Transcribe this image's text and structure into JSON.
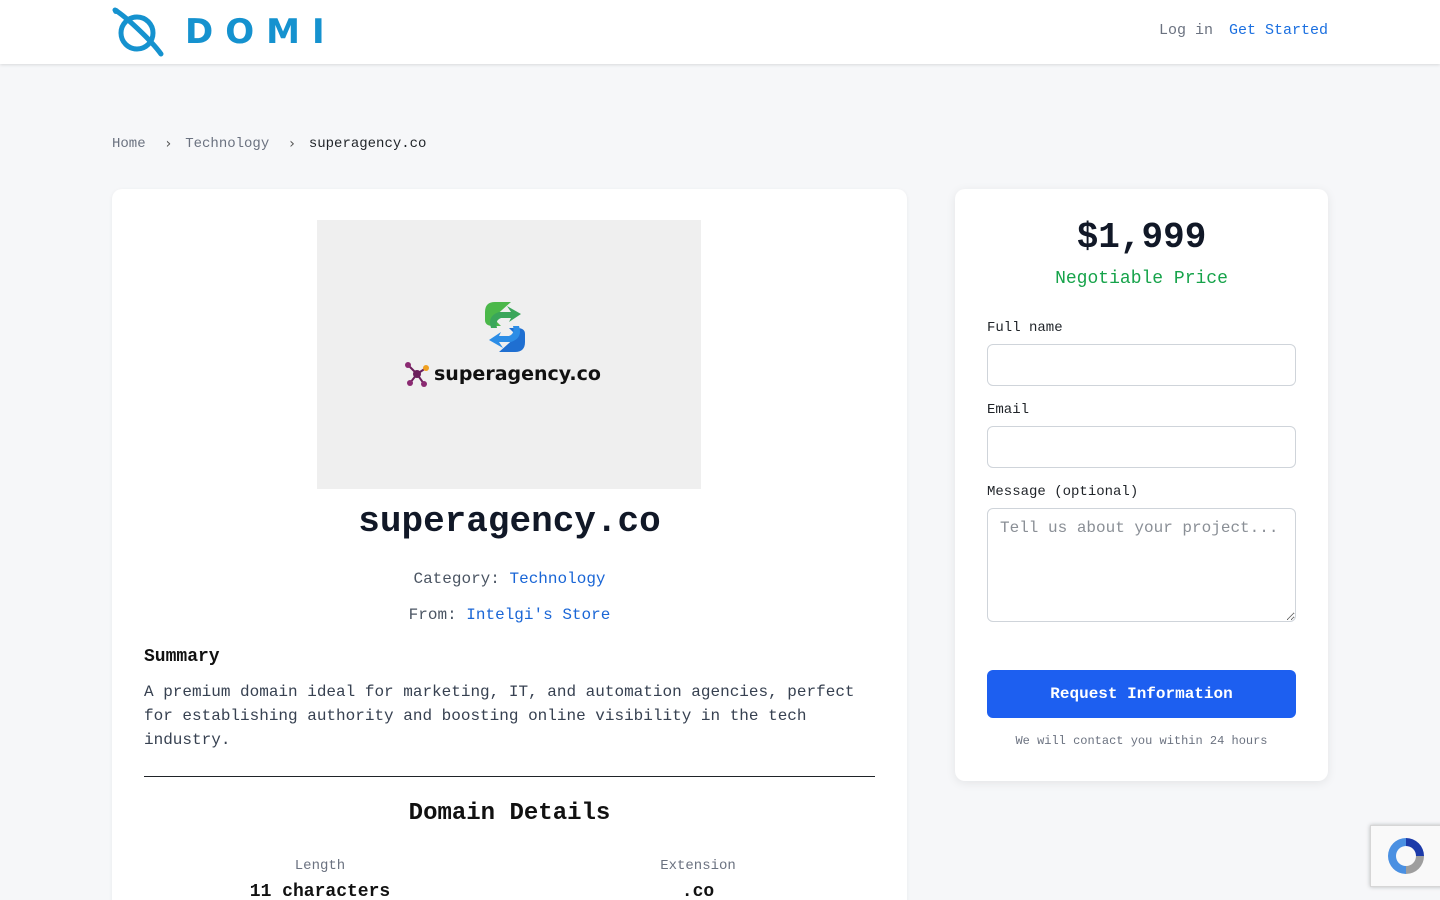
{
  "header": {
    "logo_text": "DOMI",
    "login_label": "Log in",
    "get_started_label": "Get Started"
  },
  "breadcrumb": {
    "home": "Home",
    "category": "Technology",
    "current": "superagency.co"
  },
  "listing": {
    "image_brand_text": "superagency.co",
    "domain_name": "superagency.co",
    "category_label": "Category:",
    "category_value": "Technology",
    "from_label": "From:",
    "from_value": "Intelgi's Store",
    "summary_heading": "Summary",
    "summary_text": "A premium domain ideal for marketing, IT, and automation agencies, perfect for establishing authority and boosting online visibility in the tech industry.",
    "details_heading": "Domain Details",
    "details": {
      "length_label": "Length",
      "length_value": "11 characters",
      "extension_label": "Extension",
      "extension_value": ".co"
    }
  },
  "inquiry": {
    "price": "$1,999",
    "price_note": "Negotiable Price",
    "full_name_label": "Full name",
    "full_name_value": "",
    "email_label": "Email",
    "email_value": "",
    "message_label": "Message (optional)",
    "message_placeholder": "Tell us about your project...",
    "submit_label": "Request Information",
    "contact_note": "We will contact you within 24 hours"
  },
  "colors": {
    "brand": "#1592cf",
    "link": "#1a66d6",
    "price_note": "#16a34a",
    "button": "#1d5ff0"
  },
  "icons": [
    "planet-logo-icon",
    "chevron-right-icon",
    "sync-arrows-icon",
    "molecule-icon",
    "recaptcha-icon"
  ]
}
